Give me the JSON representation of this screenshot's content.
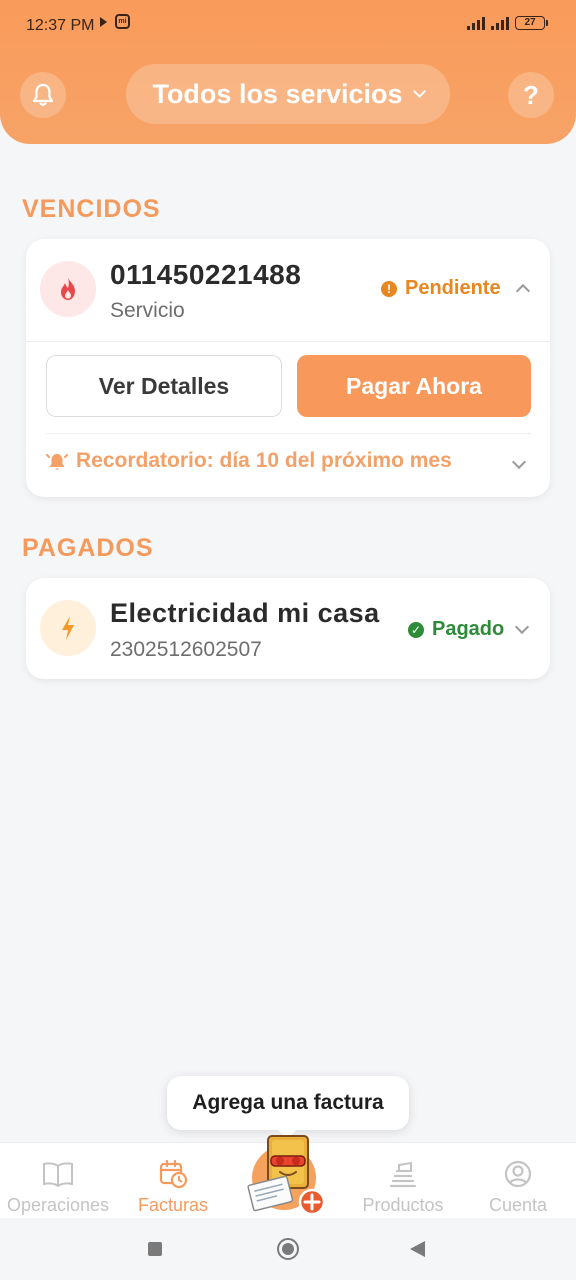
{
  "status_bar": {
    "time": "12:37 PM",
    "mi_label": "mi",
    "battery": "27"
  },
  "header": {
    "bell_icon": "bell-icon",
    "selector_label": "Todos los servicios",
    "help_label": "?"
  },
  "vencidos": {
    "title": "VENCIDOS",
    "item": {
      "icon": "fire-icon",
      "number": "011450221488",
      "subtitle": "Servicio",
      "status_label": "Pendiente",
      "status_color": "#e8861f",
      "view_details_label": "Ver Detalles",
      "pay_now_label": "Pagar Ahora",
      "reminder_label": "Recordatorio: día 10 del próximo mes"
    }
  },
  "pagados": {
    "title": "PAGADOS",
    "item": {
      "icon": "bolt-icon",
      "name": "Electricidad mi casa",
      "number": "2302512602507",
      "status_label": "Pagado",
      "status_color": "#2e8b3a"
    }
  },
  "tooltip": {
    "label": "Agrega una factura"
  },
  "bottom_nav": {
    "items": [
      {
        "label": "Operaciones",
        "icon": "book-icon",
        "active": false
      },
      {
        "label": "Facturas",
        "icon": "calendar-clock-icon",
        "active": true
      },
      {
        "label": "Productos",
        "icon": "stack-icon",
        "active": false
      },
      {
        "label": "Cuenta",
        "icon": "user-circle-icon",
        "active": false
      }
    ],
    "fab_icon": "add-invoice-mascot-icon"
  },
  "colors": {
    "accent": "#f8995b",
    "header": "#f99b5a",
    "danger": "#e8484a"
  }
}
